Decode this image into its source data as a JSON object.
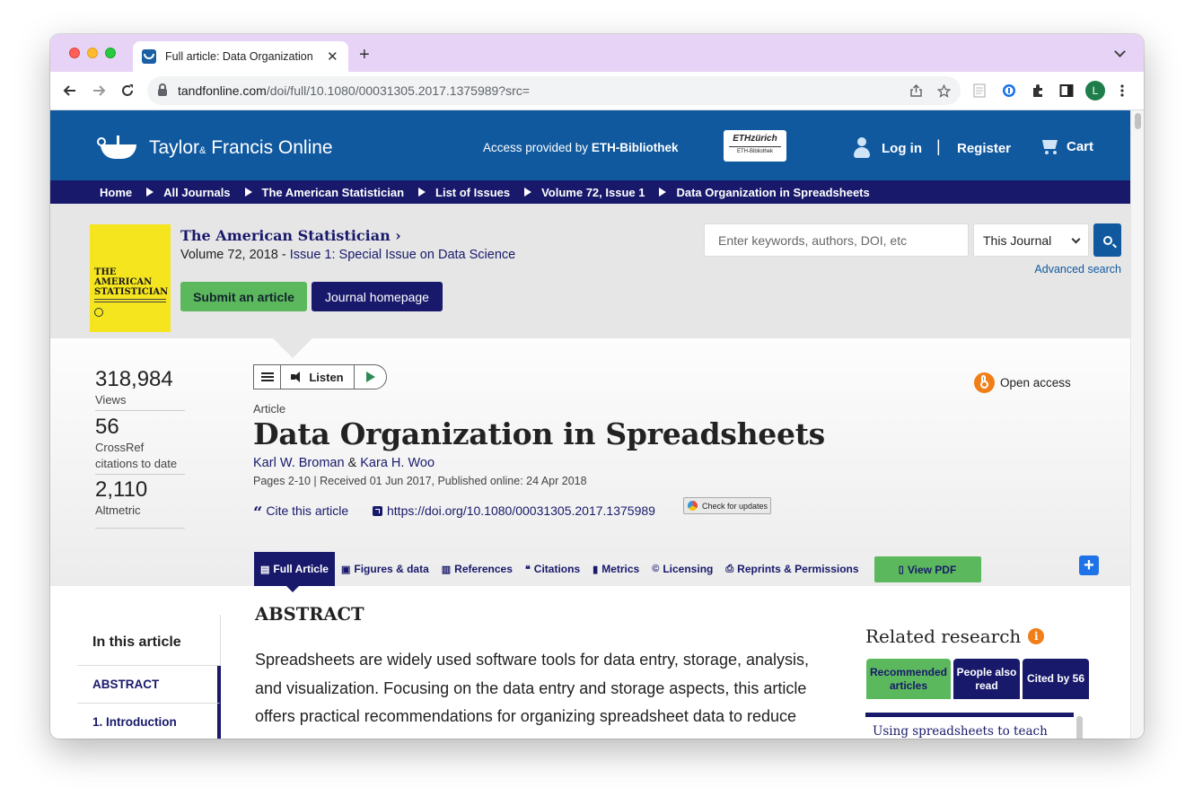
{
  "browser": {
    "tab_title": "Full article: Data Organization",
    "new_tab": "+",
    "tab_close": "✕",
    "url_host": "tandfonline.com",
    "url_path": "/doi/full/10.1080/00031305.2017.1375989?src=",
    "profile_initial": "L"
  },
  "header": {
    "logo_main": "Taylor",
    "logo_amp": "&",
    "logo_rest": "Francis Online",
    "access_prefix": "Access provided by ",
    "access_inst": "ETH-Bibliothek",
    "eth_top": "ETHzürich",
    "eth_bottom": "ETH-Bibliothek",
    "login": "Log in",
    "separator": "|",
    "register": "Register",
    "cart": "Cart"
  },
  "breadcrumb": [
    "Home",
    "All Journals",
    "The American Statistician",
    "List of Issues",
    "Volume 72, Issue 1",
    "Data Organization in Spreadsheets"
  ],
  "journal": {
    "title": "The American Statistician",
    "title_chevron": "›",
    "volume": "Volume 72, 2018 - ",
    "issue": "Issue 1: Special Issue on Data Science",
    "cover_title": "THE AMERICAN STATISTICIAN",
    "submit": "Submit an article",
    "homepage": "Journal homepage"
  },
  "search": {
    "placeholder": "Enter keywords, authors, DOI, etc",
    "scope": "This Journal",
    "advanced": "Advanced search"
  },
  "metrics": [
    {
      "value": "318,984",
      "label": "Views"
    },
    {
      "value": "56",
      "label": "CrossRef citations to date"
    },
    {
      "value": "2,110",
      "label": "Altmetric"
    }
  ],
  "article": {
    "listen": "Listen",
    "type": "Article",
    "title": "Data Organization in Spreadsheets",
    "author1": "Karl W. Broman",
    "and": " & ",
    "author2": "Kara H. Woo",
    "pubinfo": "Pages 2-10 | Received 01 Jun 2017, Published online: 24 Apr 2018",
    "cite": "Cite this article",
    "doi": "https://doi.org/10.1080/00031305.2017.1375989",
    "check_updates": "Check for updates",
    "open_access": "Open access"
  },
  "tabs": [
    {
      "label": "Full Article",
      "icon": "▤"
    },
    {
      "label": "Figures & data",
      "icon": "▣"
    },
    {
      "label": "References",
      "icon": "▥"
    },
    {
      "label": "Citations",
      "icon": "❝"
    },
    {
      "label": "Metrics",
      "icon": "▮"
    },
    {
      "label": "Licensing",
      "icon": "©"
    },
    {
      "label": "Reprints & Permissions",
      "icon": "⎙"
    },
    {
      "label": "View PDF",
      "icon": "▯"
    }
  ],
  "toc": {
    "heading": "In this article",
    "items": [
      "ABSTRACT",
      "1. Introduction"
    ]
  },
  "abstract": {
    "heading": "ABSTRACT",
    "text": "Spreadsheets are widely used software tools for data entry, storage, analysis, and visualization. Focusing on the data entry and storage aspects, this article offers practical recommendations for organizing spreadsheet data to reduce"
  },
  "related": {
    "heading": "Related research",
    "tabs": [
      "Recommended articles",
      "People also read",
      "Cited by 56"
    ],
    "first_item": "Using spreadsheets to teach"
  },
  "colors": {
    "header": "#10599f",
    "breadcrumb": "#18196b",
    "accent_green": "#5cb85c",
    "open_access": "#f07f19"
  }
}
